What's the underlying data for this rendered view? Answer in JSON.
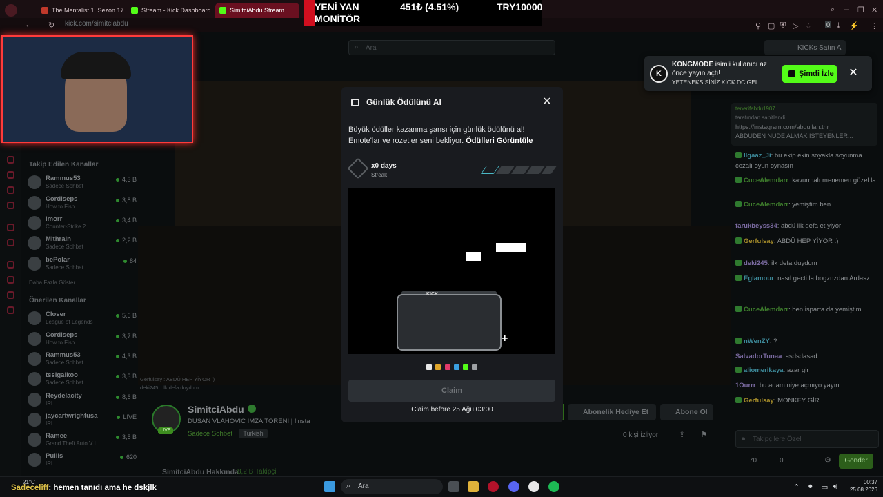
{
  "browser": {
    "tabs": [
      {
        "label": "The Mentalist 1. Sezon 17. B"
      },
      {
        "label": "Stream - Kick Dashboard"
      },
      {
        "label": "SimitciAbdu Stream"
      }
    ],
    "url": "kick.com/simitciabdu"
  },
  "ticker": {
    "headline": "YENİ YAN MONİTÖR",
    "change": "451₺ (4.51%)",
    "price": "TRY10000"
  },
  "header": {
    "search_placeholder": "Ara",
    "kicks_button": "KICKs Satın Al"
  },
  "sidebar": {
    "followed_title": "Takip Edilen Kanallar",
    "followed": [
      {
        "name": "Rammus53",
        "category": "Sadece Sohbet",
        "viewers": "4,3 B"
      },
      {
        "name": "Cordiseps",
        "category": "How to Fish",
        "viewers": "3,8 B"
      },
      {
        "name": "imorr",
        "category": "Counter-Strike 2",
        "viewers": "3,4 B"
      },
      {
        "name": "Mithrain",
        "category": "Sadece Sohbet",
        "viewers": "2,2 B"
      },
      {
        "name": "bePolar",
        "category": "Sadece Sohbet",
        "viewers": "84"
      }
    ],
    "show_more": "Daha Fazla Göster",
    "recommended_title": "Önerilen Kanallar",
    "recommended": [
      {
        "name": "Closer",
        "category": "League of Legends",
        "viewers": "5,6 B"
      },
      {
        "name": "Cordiseps",
        "category": "How to Fish",
        "viewers": "3,7 B"
      },
      {
        "name": "Rammus53",
        "category": "Sadece Sohbet",
        "viewers": "4,3 B"
      },
      {
        "name": "tssigalkoo",
        "category": "Sadece Sohbet",
        "viewers": "3,3 B"
      },
      {
        "name": "Reydelacity",
        "category": "IRL",
        "viewers": "8,6 B"
      },
      {
        "name": "jaycartwrightusa",
        "category": "IRL",
        "viewers": "LIVE"
      },
      {
        "name": "Ramee",
        "category": "Grand Theft Auto V I...",
        "viewers": "3,5 B"
      },
      {
        "name": "Pullis",
        "category": "IRL",
        "viewers": "620"
      }
    ]
  },
  "stream_chat_overlay": [
    "Gerfulsay : ABDÜ HEP YİYOR :)",
    "deki245 : ilk defa duydum"
  ],
  "stream": {
    "channel": "SimitciAbdu",
    "live_badge": "LIVE",
    "title": "DUSAN VLAHOVİC İMZA TÖRENİ | !insta",
    "category": "Sadece Sohbet",
    "language": "Turkish",
    "gift_label": "Abonelik Hediye Et",
    "subscribe_label": "Abone Ol",
    "viewers_label": "0 kişi izliyor",
    "about_label": "SimitciAbdu Hakkında",
    "followers_label": "8,2 B Takipçi"
  },
  "notification": {
    "logo": "K",
    "title_bold": "KONGMODE",
    "title_rest": " isimli kullanıcı az önce yayın açtı!",
    "subtitle": "YETENEKSİSİNİZ KİCK DC GEL...",
    "button": "Şimdi İzle",
    "close": "✕"
  },
  "modal": {
    "title": "Günlük Ödülünü Al",
    "close": "✕",
    "description": "Büyük ödüller kazanma şansı için günlük ödülünü al! Emote'lar ve rozetler seni bekliyor. ",
    "link": "Ödülleri Görüntüle",
    "days": "x0 days",
    "streak_label": "Streak",
    "box_label": "KICK",
    "claim": "Claim",
    "claim_before": "Claim before 25 Ağu 03:00"
  },
  "chat": {
    "pinned": {
      "user": "tenerifabdu1907",
      "pinned_by": "tarafından sabitlendi",
      "link": "https://instagram.com/abdullah.tnr_",
      "text": "ABDÜDEN NUDE ALMAK İSTEYENLER..."
    },
    "messages": [
      {
        "user": "Ilgaaz_Ji",
        "text": ": bu ekip ekin soyakla soyunma cezalı oyun oynasın"
      },
      {
        "user": "CuceAlemdarr",
        "text": ": kavurmalı menemen güzel la"
      },
      {
        "user": "CuceAlemdarr",
        "text": ": yemiştim ben"
      },
      {
        "user": "farukbeyss34",
        "text": ": abdü ilk defa et yiyor"
      },
      {
        "user": "Gerfulsay",
        "text": ": ABDÜ HEP YİYOR :)"
      },
      {
        "user": "deki245",
        "text": ": ilk defa duydum"
      },
      {
        "user": "Eglamour",
        "text": ": nasıl gecti la bogznzdan Ardasz"
      },
      {
        "user": "CuceAlemdarr",
        "text": ": ben isparta da yemiştim"
      },
      {
        "user": "nWenZY",
        "text": ": ?"
      },
      {
        "user": "SalvadorTunaa",
        "text": ": asdsdasad"
      },
      {
        "user": "aliomerikaya",
        "text": ": azar gir"
      },
      {
        "user": "1Ourrr",
        "text": ": bu adam niye açmıyo yayın"
      },
      {
        "user": "Gerfulsay",
        "text": ": MONKEY GİR"
      }
    ],
    "input_placeholder": "Takipçilere Özel",
    "points": "70",
    "points2": "0",
    "send": "Gönder"
  },
  "taskbar": {
    "weather": "21°C",
    "overlay_user": "Sadeceliff",
    "overlay_text": ": hemen tanıdı ama he dskjlk",
    "search": "Ara",
    "time": "00:37",
    "date": "25.08.2026"
  },
  "colors": {
    "kick_green": "#53fc18",
    "modal_bg": "#191b1f",
    "cam_border": "#ff3b3b"
  }
}
